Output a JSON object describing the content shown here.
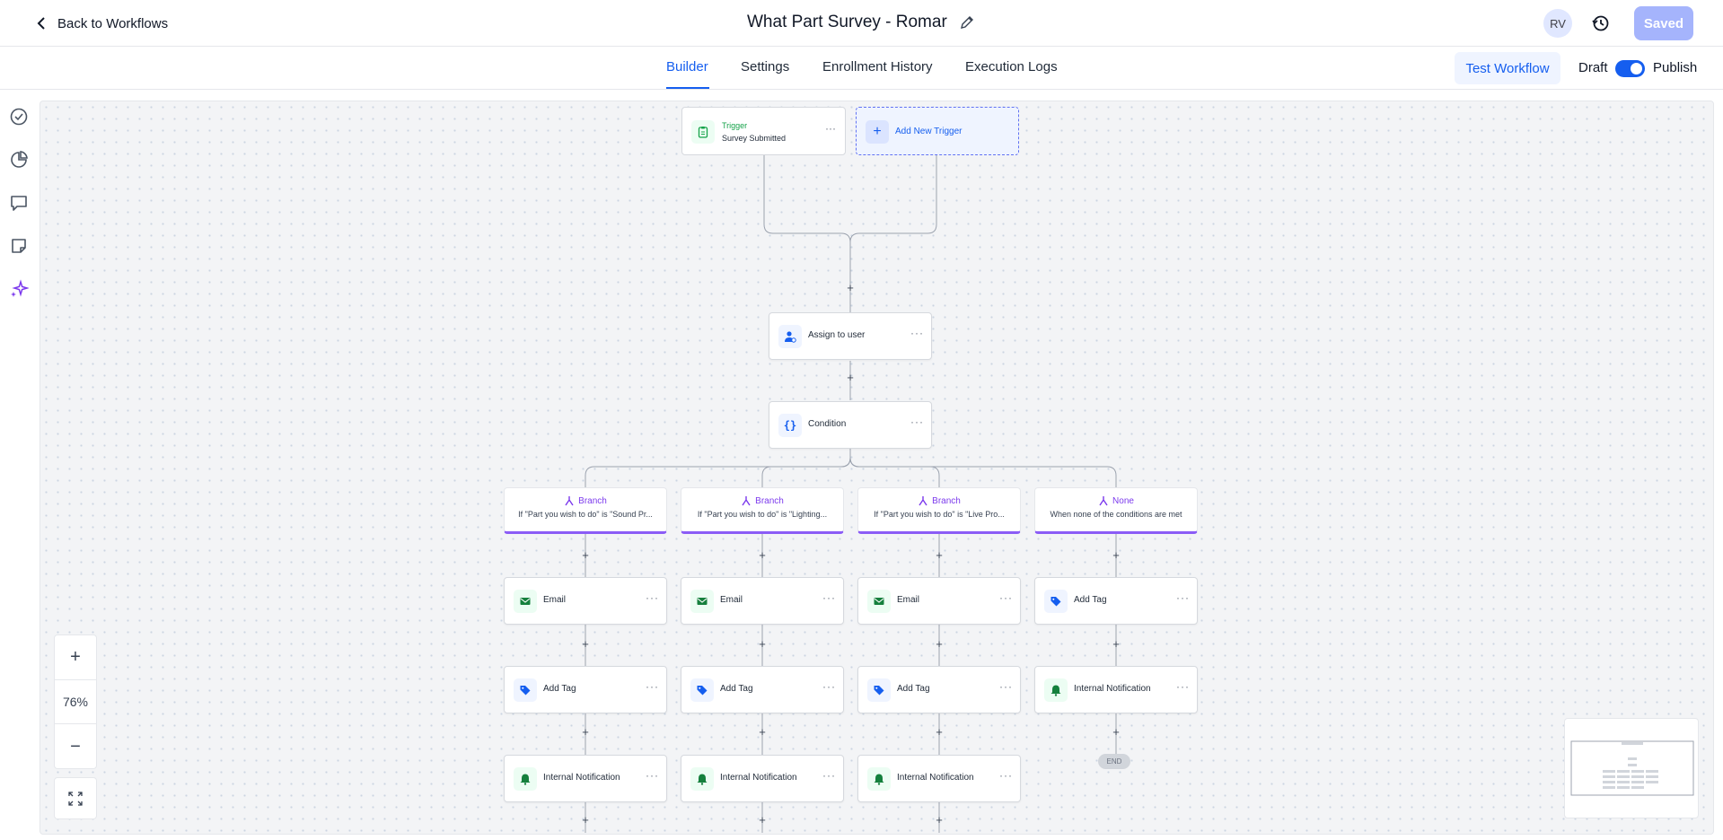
{
  "header": {
    "back_label": "Back to Workflows",
    "title": "What Part Survey - Romar",
    "avatar_initials": "RV",
    "saved_label": "Saved"
  },
  "tabs": [
    {
      "label": "Builder",
      "active": true
    },
    {
      "label": "Settings",
      "active": false
    },
    {
      "label": "Enrollment History",
      "active": false
    },
    {
      "label": "Execution Logs",
      "active": false
    }
  ],
  "toolbar": {
    "test_label": "Test Workflow",
    "draft_label": "Draft",
    "publish_label": "Publish",
    "publish_toggle_on": true
  },
  "sidebar": {
    "icons": [
      "check-circle-icon",
      "pie-chart-icon",
      "comment-icon",
      "note-icon",
      "sparkles-icon"
    ]
  },
  "canvas": {
    "trigger": {
      "title": "Trigger",
      "subtitle": "Survey Submitted"
    },
    "add_trigger_label": "Add New Trigger",
    "assign_label": "Assign to user",
    "condition_label": "Condition",
    "branches": [
      {
        "title": "Branch",
        "desc": "If \"Part you wish to do\" is \"Sound Pr...",
        "steps": [
          "Email",
          "Add Tag",
          "Internal Notification"
        ]
      },
      {
        "title": "Branch",
        "desc": "If \"Part you wish to do\" is \"Lighting...",
        "steps": [
          "Email",
          "Add Tag",
          "Internal Notification"
        ]
      },
      {
        "title": "Branch",
        "desc": "If \"Part you wish to do\" is \"Live Pro...",
        "steps": [
          "Email",
          "Add Tag",
          "Internal Notification"
        ]
      },
      {
        "title": "None",
        "desc": "When none of the conditions are met",
        "steps": [
          "Add Tag",
          "Internal Notification"
        ]
      }
    ],
    "end_label": "END"
  },
  "zoom": {
    "value": "76%"
  },
  "colors": {
    "accent": "#155eef",
    "branch": "#8b5cf6",
    "saved_button": "#a5b4fc"
  }
}
